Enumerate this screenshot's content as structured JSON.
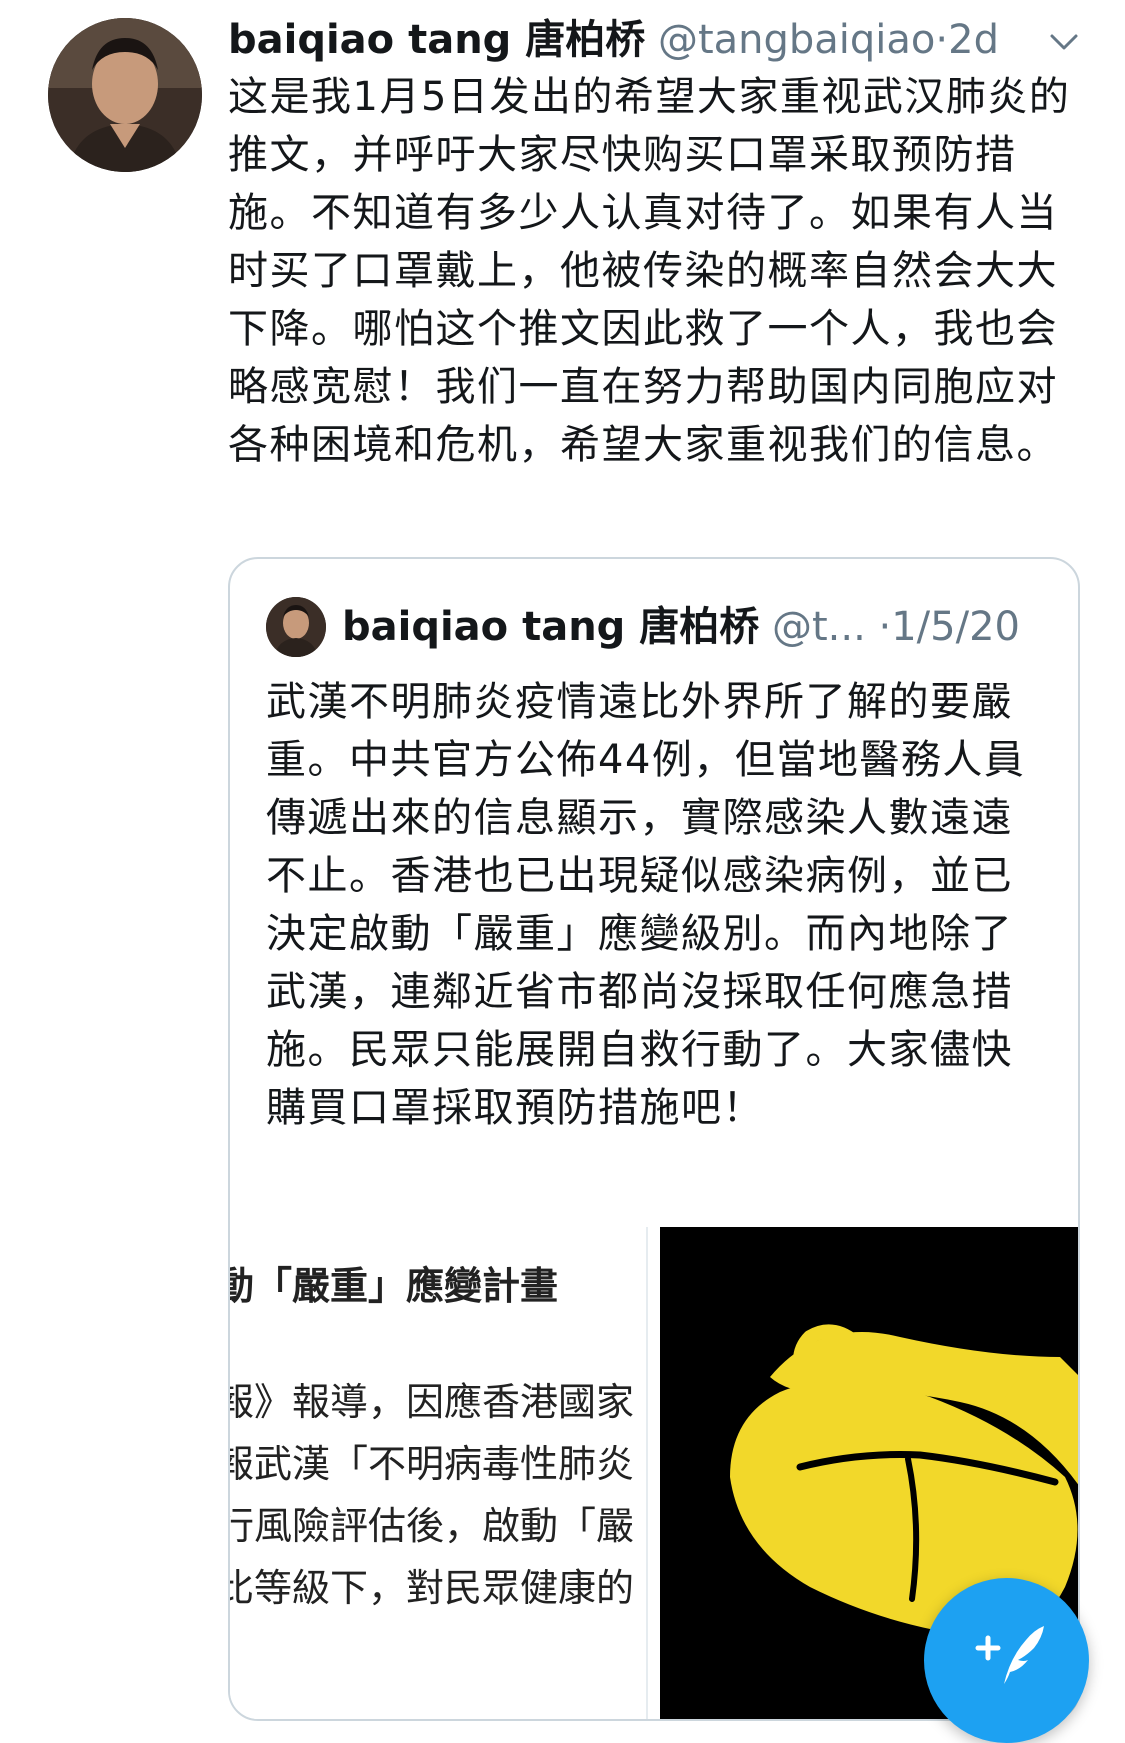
{
  "tweet": {
    "author": {
      "display_name": "baiqiao tang 唐柏桥",
      "handle": "@tangbaiqiao",
      "separator": "·",
      "time": "2d"
    },
    "text": "这是我1月5日发出的希望大家重视武汉肺炎的推文，并呼吁大家尽快购买口罩采取预防措施。不知道有多少人认真对待了。如果有人当时买了口罩戴上，他被传染的概率自然会大大下降。哪怕这个推文因此救了一个人，我也会略感宽慰！我们一直在努力帮助国内同胞应对各种困境和危机，希望大家重视我们的信息。",
    "menu_icon": "chevron-down-icon"
  },
  "quoted_tweet": {
    "author": {
      "display_name": "baiqiao tang 唐柏桥",
      "handle": "@t...",
      "separator": "·",
      "time": "1/5/20"
    },
    "text": "武漢不明肺炎疫情遠比外界所了解的要嚴重。中共官方公佈44例，但當地醫務人員傳遞出來的信息顯示，實際感染人數遠遠不止。香港也已出現疑似感染病例，並已決定啟動「嚴重」應變級別。而內地除了武漢，連鄰近省市都尚沒採取任何應急措施。民眾只能展開自救行動了。大家儘快購買口罩採取預防措施吧！",
    "media": {
      "article_headline": "動「嚴重」應變計畫",
      "article_lines": [
        "報》報導，因應香港國家",
        "報武漢「不明病毒性肺炎",
        "行風險評估後，啟動「嚴",
        "比等級下，對民眾健康的"
      ],
      "image_subject": "yellow-face-mask",
      "mask_color": "#f2d82a"
    }
  },
  "compose_button": {
    "icon": "compose-tweet-icon",
    "color": "#1da1f2"
  }
}
